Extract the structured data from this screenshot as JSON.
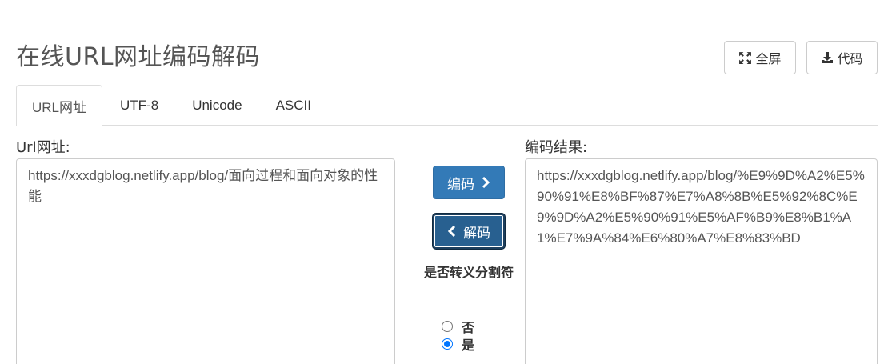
{
  "page": {
    "title": "在线URL网址编码解码"
  },
  "toolbar": {
    "fullscreen_label": "全屏",
    "code_label": "代码",
    "fullscreen_icon": "expand-icon",
    "code_icon": "download-icon"
  },
  "tabs": [
    {
      "label": "URL网址",
      "active": true
    },
    {
      "label": "UTF-8",
      "active": false
    },
    {
      "label": "Unicode",
      "active": false
    },
    {
      "label": "ASCII",
      "active": false
    }
  ],
  "input": {
    "label": "Url网址:",
    "value": "https://xxxdgblog.netlify.app/blog/面向过程和面向对象的性能"
  },
  "output": {
    "label": "编码结果:",
    "value": "https://xxxdgblog.netlify.app/blog/%E9%9D%A2%E5%90%91%E8%BF%87%E7%A8%8B%E5%92%8C%E9%9D%A2%E5%90%91%E5%AF%B9%E8%B1%A1%E7%9A%84%E6%80%A7%E8%83%BD"
  },
  "actions": {
    "encode_label": "编码",
    "decode_label": "解码",
    "encode_icon": "chevron-right-icon",
    "decode_icon": "chevron-left-icon"
  },
  "escape_option": {
    "title": "是否转义分割符",
    "options": [
      {
        "label": "否",
        "checked": false
      },
      {
        "label": "是",
        "checked": true
      }
    ]
  },
  "colors": {
    "primary": "#337ab7",
    "primary_active": "#286090",
    "radio_checked": "#0075ff"
  }
}
